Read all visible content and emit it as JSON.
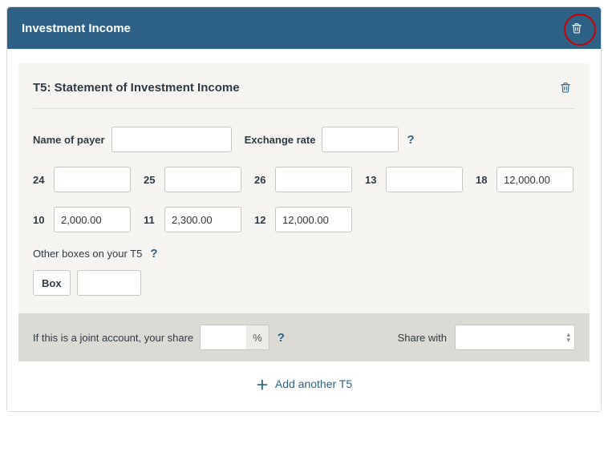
{
  "header": {
    "title": "Investment Income"
  },
  "panel": {
    "title": "T5: Statement of Investment Income",
    "payer_label": "Name of payer",
    "payer_value": "",
    "exchange_label": "Exchange rate",
    "exchange_value": "",
    "boxes": {
      "24": "",
      "25": "",
      "26": "",
      "13": "",
      "18": "12,000.00",
      "10": "2,000.00",
      "11": "2,300.00",
      "12": "12,000.00"
    },
    "other_label": "Other boxes on your T5",
    "box_chip": "Box",
    "box_value": ""
  },
  "footer": {
    "joint_label": "If this is a joint account, your share",
    "pct_value": "",
    "pct_symbol": "%",
    "share_label": "Share with",
    "share_value": ""
  },
  "add_label": "Add another T5",
  "help_glyph": "?"
}
